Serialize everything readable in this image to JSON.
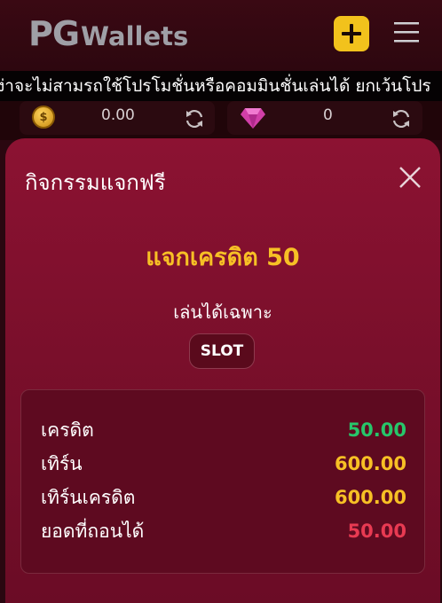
{
  "header": {
    "logo_pg": "PG",
    "logo_wallets": "Wallets",
    "add_icon": "plus-icon",
    "menu_icon": "hamburger-menu-icon"
  },
  "ticker": {
    "text": "ง่าจะไม่สามรถใช้โปรโมชั่นหรือคอมมินชั่นเล่นได้ ยกเว้นโปร"
  },
  "balances": {
    "coin": {
      "value": "0.00",
      "icon": "gold-coin-icon"
    },
    "gem": {
      "value": "0",
      "icon": "diamond-gem-icon"
    }
  },
  "modal": {
    "title": "กิจกรรมแจกฟรี",
    "credit_title": "แจกเครดิต 50",
    "play_only_label": "เล่นได้เฉพาะ",
    "slot_chip": "SLOT",
    "rows": [
      {
        "label": "เครดิต",
        "value": "50.00",
        "color": "#27c66a"
      },
      {
        "label": "เทิร์น",
        "value": "600.00",
        "color": "#f7c025"
      },
      {
        "label": "เทิร์นเครดิต",
        "value": "600.00",
        "color": "#f7c025"
      },
      {
        "label": "ยอดที่ถอนได้",
        "value": "50.00",
        "color": "#e83a52"
      }
    ]
  },
  "colors": {
    "accent_yellow": "#f2c21c",
    "modal_bg": "#8c1232",
    "credit_title": "#f7c025"
  }
}
